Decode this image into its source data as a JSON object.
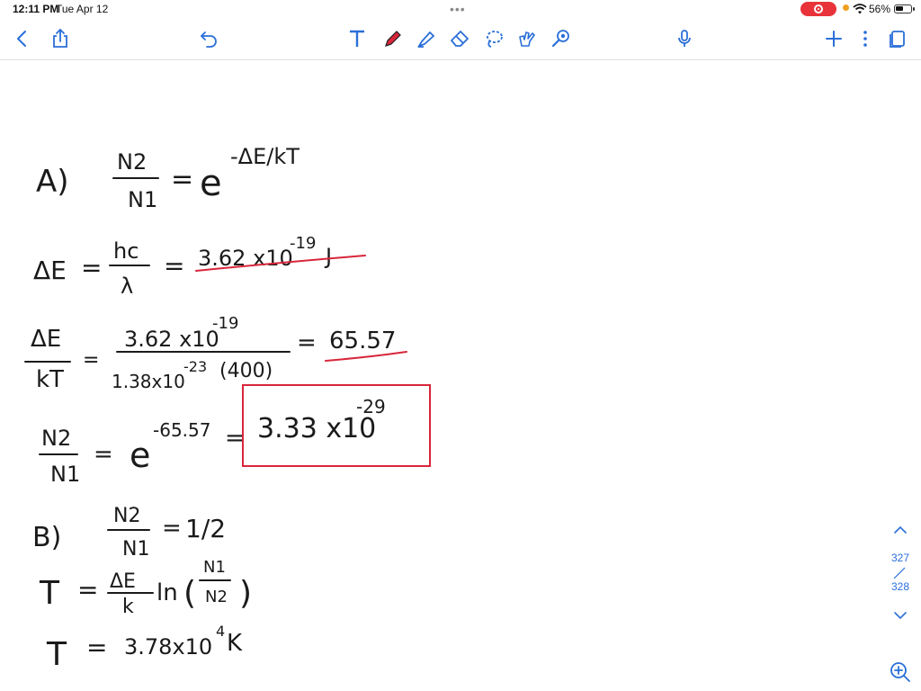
{
  "status_bar": {
    "time": "12:11 PM",
    "date": "Tue Apr 12",
    "dots": "•••",
    "battery_percent": "56%",
    "battery_level": 0.56
  },
  "toolbar": {
    "icons": [
      "back-icon",
      "share-icon",
      "undo-icon",
      "text-tool-icon",
      "pen-icon",
      "highlighter-icon",
      "eraser-icon",
      "lasso-icon",
      "image-tool-icon",
      "laser-pointer-icon",
      "microphone-icon",
      "add-page-icon",
      "more-options-icon",
      "pages-icon"
    ]
  },
  "colors": {
    "accent": "#2a6fd8",
    "ink": "#1a1a1a",
    "red_ink": "#d8263a",
    "record": "#e8333a"
  },
  "notes": {
    "a_label": "A)",
    "a_frac_num": "N2",
    "a_frac_den": "N1",
    "a_eq": "=",
    "a_base": "e",
    "a_exp": "-ΔE/kT",
    "de_lhs": "ΔE",
    "de_eq1": "=",
    "de_frac_num": "hc",
    "de_frac_den": "λ",
    "de_eq2": "=",
    "de_value": "3.62 x10",
    "de_exp": "-19",
    "de_unit": "J",
    "ratio_num": "ΔE",
    "ratio_den": "kT",
    "ratio_eq": "=",
    "ratio_calc_num": "3.62 x10",
    "ratio_calc_num_exp": "-19",
    "ratio_calc_den": "1.38x10",
    "ratio_calc_den_exp": "-23",
    "ratio_calc_den_tail": "(400)",
    "ratio_eq2": "=",
    "ratio_value": "65.57",
    "pop_num": "N2",
    "pop_den": "N1",
    "pop_eq": "=",
    "pop_base": "e",
    "pop_exp": "-65.57",
    "pop_eq2": "=",
    "pop_result": "3.33 x10",
    "pop_result_exp": "-29",
    "b_label": "B)",
    "b_frac_num": "N2",
    "b_frac_den": "N1",
    "b_eq": "=",
    "b_value": "1/2",
    "t_lhs": "T",
    "t_eq": "=",
    "t_frac_num": "ΔE",
    "t_frac_den": "k",
    "t_ln": "ln",
    "t_paren_open": "(",
    "t_in_num": "N1",
    "t_in_den": "N2",
    "t_paren_close": ")",
    "t2_lhs": "T",
    "t2_eq": "=",
    "t2_value": "3.78x10",
    "t2_exp": "4",
    "t2_unit": "K"
  },
  "page_nav": {
    "current": "327",
    "total": "328"
  }
}
